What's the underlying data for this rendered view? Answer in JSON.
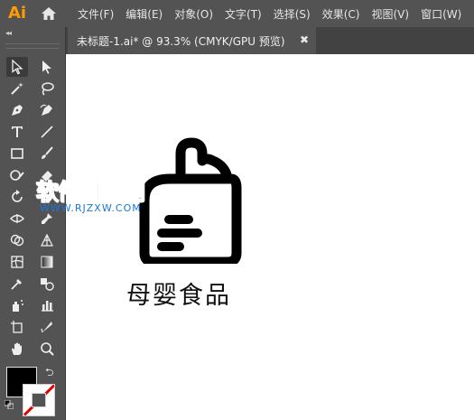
{
  "app": {
    "logo_text": "Ai"
  },
  "menu": [
    "文件(F)",
    "编辑(E)",
    "对象(O)",
    "文字(T)",
    "选择(S)",
    "效果(C)",
    "视图(V)",
    "窗口(W)"
  ],
  "toolbar": {
    "collapse_glyph": "◂◂"
  },
  "document_tab": {
    "title": "未标题-1.ai* @ 93.3% (CMYK/GPU 预览)",
    "close_glyph": "✖"
  },
  "watermark": {
    "cn": "软件自学网",
    "en": "WWW.RJZXW.COM"
  },
  "artwork": {
    "caption": "母婴食品"
  },
  "colors": {
    "fill": "#000000",
    "stroke": "none",
    "accent": "#ff9a00",
    "watermark": "#1a78d8"
  }
}
